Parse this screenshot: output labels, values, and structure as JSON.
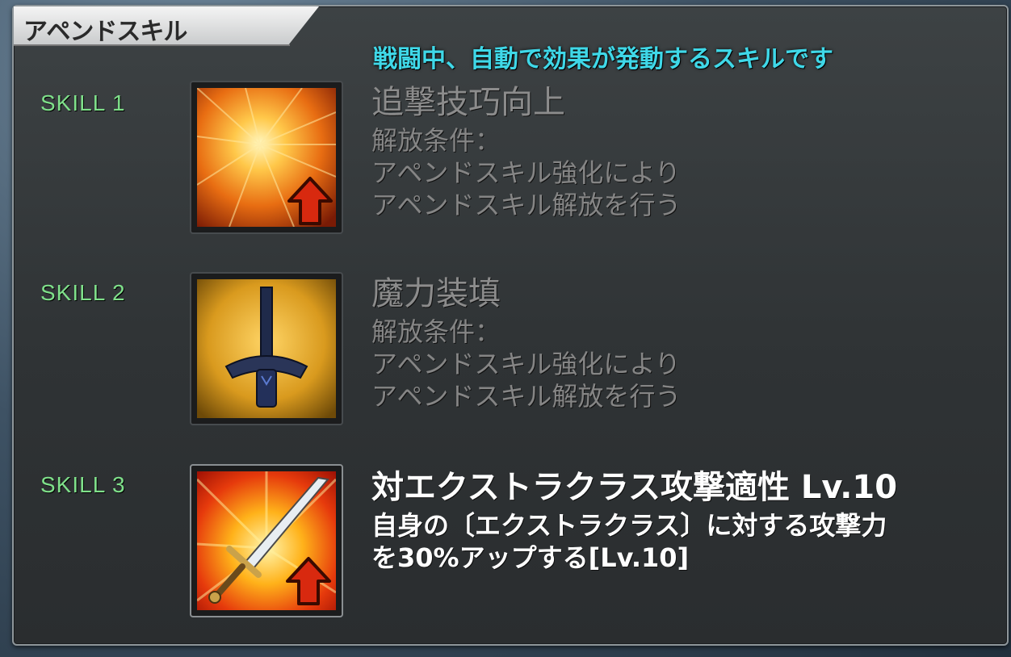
{
  "panel": {
    "title": "アペンドスキル",
    "hint": "戦闘中、自動で効果が発動するスキルです"
  },
  "skills": [
    {
      "label": "SKILL 1",
      "name": "追撃技巧向上",
      "desc": "解放条件：\nアペンドスキル強化により\nアペンドスキル解放を行う",
      "icon": "burst-arrow-up-icon",
      "locked": true
    },
    {
      "label": "SKILL 2",
      "name": "魔力装填",
      "desc": "解放条件：\nアペンドスキル強化により\nアペンドスキル解放を行う",
      "icon": "sword-icon",
      "locked": true
    },
    {
      "label": "SKILL 3",
      "name": "対エクストラクラス攻撃適性 Lv.10",
      "desc": "自身の〔エクストラクラス〕に対する攻撃力\nを30%アップする[Lv.10]",
      "icon": "sword-arrow-up-icon",
      "locked": false
    }
  ],
  "colors": {
    "hint": "#3fd8e8",
    "skill_label": "#7fe08a",
    "locked_text": "#858585",
    "active_text": "#ffffff"
  }
}
